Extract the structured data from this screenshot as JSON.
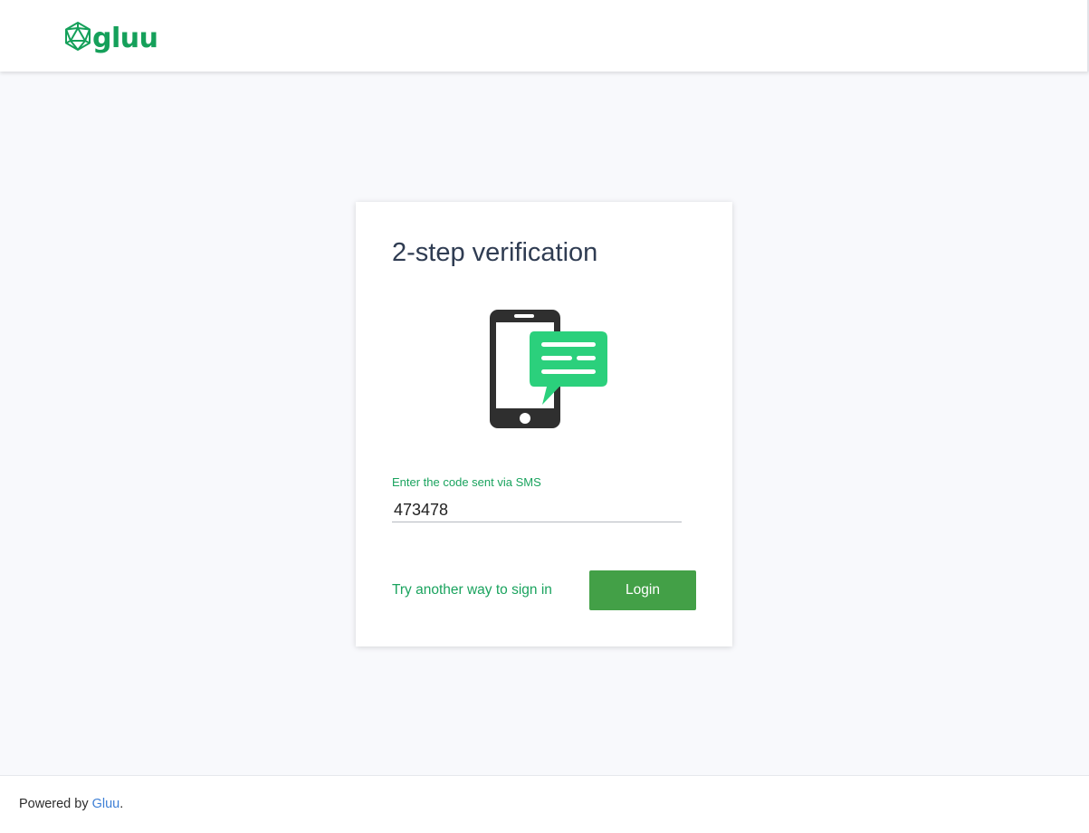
{
  "header": {
    "logo_text": "gluu",
    "logo_icon": "icosahedron-logo-icon",
    "brand_color": "#15a05a"
  },
  "card": {
    "title": "2-step verification",
    "illustration_icon": "phone-sms-icon",
    "code_label": "Enter the code sent via SMS",
    "code_value": "473478",
    "alt_link_label": "Try another way to sign in",
    "login_label": "Login",
    "button_color": "#43a047",
    "accent_color": "#1aa35e"
  },
  "footer": {
    "prefix": "Powered by ",
    "link_label": "Gluu",
    "suffix": ".",
    "link_color": "#3d7fd6"
  }
}
